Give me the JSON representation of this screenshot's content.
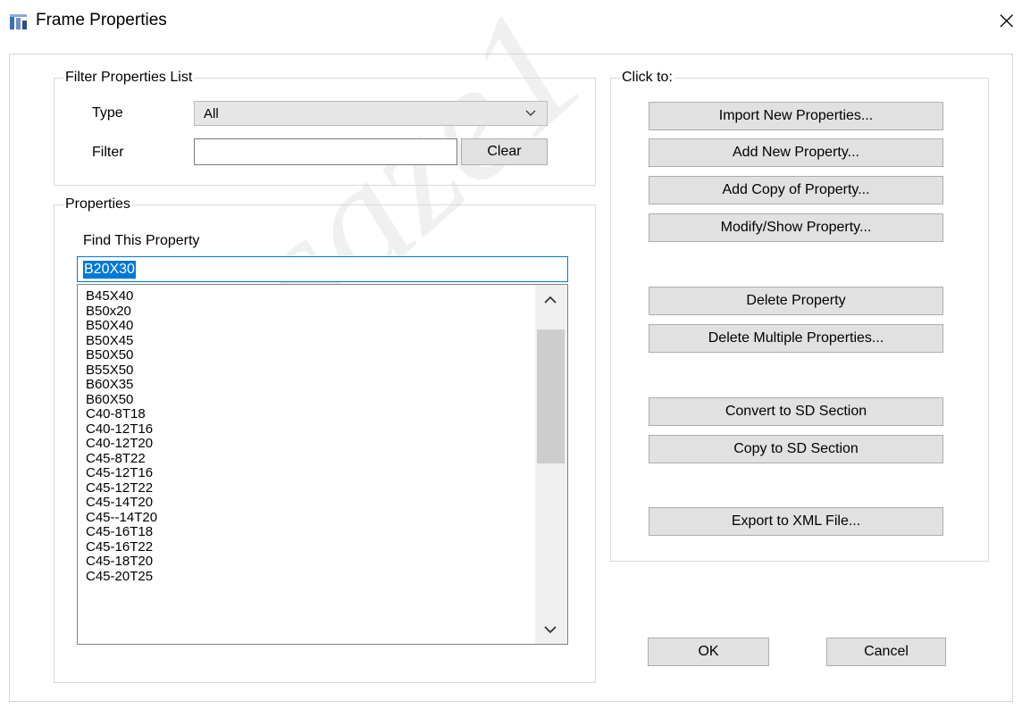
{
  "window": {
    "title": "Frame Properties",
    "watermark": "saze1"
  },
  "filter": {
    "legend": "Filter Properties List",
    "type_label": "Type",
    "type_value": "All",
    "filter_label": "Filter",
    "filter_value": "",
    "clear_label": "Clear"
  },
  "properties": {
    "legend": "Properties",
    "find_label": "Find This Property",
    "find_value": "B20X30",
    "items": [
      "B45X40",
      "B50x20",
      "B50X40",
      "B50X45",
      "B50X50",
      "B55X50",
      "B60X35",
      "B60X50",
      "C40-8T18",
      "C40-12T16",
      "C40-12T20",
      "C45-8T22",
      "C45-12T16",
      "C45-12T22",
      "C45-14T20",
      "C45--14T20",
      "C45-16T18",
      "C45-16T22",
      "C45-18T20",
      "C45-20T25"
    ]
  },
  "actions": {
    "legend": "Click to:",
    "import": "Import New Properties...",
    "add_new": "Add New Property...",
    "add_copy": "Add Copy of Property...",
    "modify": "Modify/Show Property...",
    "delete": "Delete Property",
    "delete_multiple": "Delete Multiple Properties...",
    "convert_sd": "Convert to SD Section",
    "copy_sd": "Copy to SD Section",
    "export_xml": "Export to XML File..."
  },
  "footer": {
    "ok": "OK",
    "cancel": "Cancel"
  },
  "colors": {
    "selection": "#0078d7",
    "button_bg": "#e1e1e1"
  }
}
